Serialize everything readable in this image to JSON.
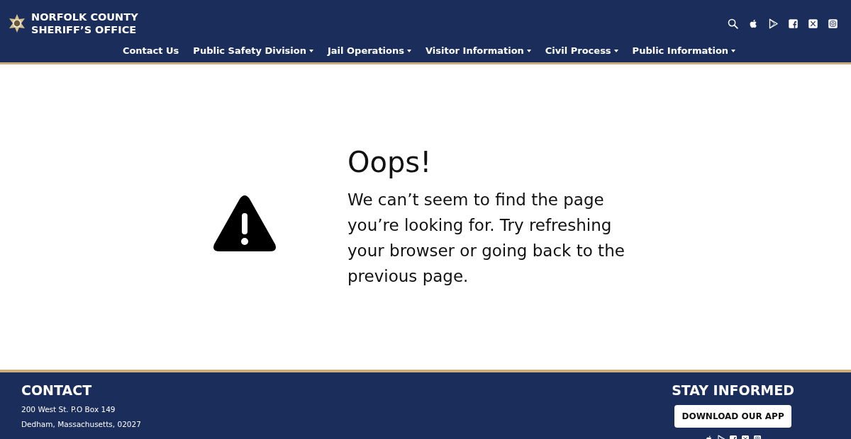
{
  "header": {
    "logo_lines": [
      "NORFOLK COUNTY",
      "SHERIFF’S OFFICE"
    ],
    "icons": [
      {
        "kind": "search"
      },
      {
        "kind": "apple"
      },
      {
        "kind": "play"
      },
      {
        "kind": "facebook"
      },
      {
        "kind": "x"
      },
      {
        "kind": "instagram"
      }
    ],
    "nav": [
      {
        "label": "Contact Us",
        "kind": "link"
      },
      {
        "label": "Public Safety Division",
        "kind": "dropdown"
      },
      {
        "label": "Jail Operations",
        "kind": "dropdown"
      },
      {
        "label": "Visitor Information",
        "kind": "dropdown"
      },
      {
        "label": "Civil Process",
        "kind": "dropdown"
      },
      {
        "label": "Public Information",
        "kind": "dropdown"
      }
    ]
  },
  "error": {
    "title": "Oops!",
    "message": "We can’t seem to find the page you’re looking for. Try refreshing your browser or going back to the previous page."
  },
  "footer": {
    "contact_heading": "CONTACT",
    "contact_lines": [
      "200 West St. P.O Box 149",
      "Dedham, Massachusetts, 02027"
    ],
    "stay_heading": "STAY INFORMED",
    "app_button": "DOWNLOAD OUR APP",
    "icons": [
      {
        "kind": "apple"
      },
      {
        "kind": "play"
      },
      {
        "kind": "facebook"
      },
      {
        "kind": "x"
      },
      {
        "kind": "instagram"
      }
    ]
  }
}
